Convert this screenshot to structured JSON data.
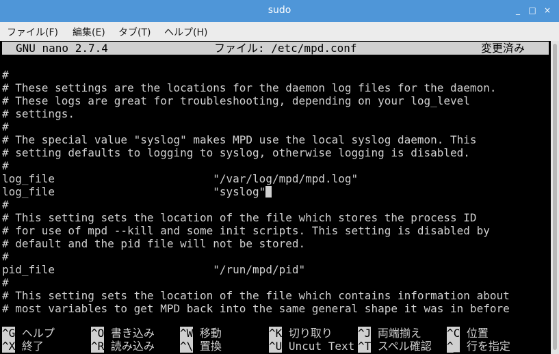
{
  "window": {
    "title": "sudo",
    "minimize_glyph": "_",
    "maximize_glyph": "□",
    "close_glyph": "×"
  },
  "menubar": {
    "items": [
      {
        "label": "ファイル(F)"
      },
      {
        "label": "編集(E)"
      },
      {
        "label": "タブ(T)"
      },
      {
        "label": "ヘルプ(H)"
      }
    ]
  },
  "nano": {
    "version": "GNU nano 2.7.4",
    "file": "ファイル: /etc/mpd.conf",
    "status": "変更済み"
  },
  "editor": {
    "lines": [
      "#",
      "# These settings are the locations for the daemon log files for the daemon.",
      "# These logs are great for troubleshooting, depending on your log_level",
      "# settings.",
      "#",
      "# The special value \"syslog\" makes MPD use the local syslog daemon. This",
      "# setting defaults to logging to syslog, otherwise logging is disabled.",
      "#",
      "log_file                        \"/var/log/mpd/mpd.log\"",
      "log_file                        \"syslog\"",
      "#",
      "# This setting sets the location of the file which stores the process ID",
      "# for use of mpd --kill and some init scripts. This setting is disabled by",
      "# default and the pid file will not be stored.",
      "#",
      "pid_file                        \"/run/mpd/pid\"",
      "#",
      "# This setting sets the location of the file which contains information about",
      "# most variables to get MPD back into the same general shape it was in before"
    ],
    "cursor_line": 9
  },
  "shortcuts": {
    "row1": [
      {
        "key": "^G",
        "label": "ヘルプ"
      },
      {
        "key": "^O",
        "label": "書き込み"
      },
      {
        "key": "^W",
        "label": "移動"
      },
      {
        "key": "^K",
        "label": "切り取り"
      },
      {
        "key": "^J",
        "label": "両端揃え"
      },
      {
        "key": "^C",
        "label": "位置"
      }
    ],
    "row2": [
      {
        "key": "^X",
        "label": "終了"
      },
      {
        "key": "^R",
        "label": "読み込み"
      },
      {
        "key": "^\\",
        "label": "置換"
      },
      {
        "key": "^U",
        "label": "Uncut Text"
      },
      {
        "key": "^T",
        "label": "スペル確認"
      },
      {
        "key": "^_",
        "label": "行を指定"
      }
    ]
  }
}
